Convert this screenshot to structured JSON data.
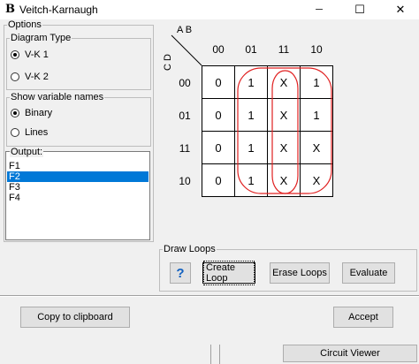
{
  "window": {
    "icon_glyph": "B",
    "title": "Veitch-Karnaugh",
    "min_glyph": "─",
    "max_glyph": "☐",
    "close_glyph": "✕"
  },
  "options": {
    "title": "Options",
    "diagram_type": {
      "title": "Diagram Type",
      "choices": [
        "V-K 1",
        "V-K 2"
      ],
      "selected": "V-K 1"
    },
    "variable_names": {
      "title": "Show variable names",
      "choices": [
        "Binary",
        "Lines"
      ],
      "selected": "Binary"
    }
  },
  "output": {
    "title": "Output:",
    "items": [
      "F1",
      "F2",
      "F3",
      "F4"
    ],
    "selected": "F2"
  },
  "kmap": {
    "row_var_label": "C D",
    "col_var_label": "A B",
    "col_headers": [
      "00",
      "01",
      "11",
      "10"
    ],
    "row_headers": [
      "00",
      "01",
      "11",
      "10"
    ],
    "cells": [
      [
        "0",
        "1",
        "X",
        "1"
      ],
      [
        "0",
        "1",
        "X",
        "1"
      ],
      [
        "0",
        "1",
        "X",
        "X"
      ],
      [
        "0",
        "1",
        "X",
        "X"
      ]
    ],
    "loop_color": "#e02020"
  },
  "draw_loops": {
    "title": "Draw Loops",
    "help_label": "?",
    "create_label": "Create Loop",
    "erase_label": "Erase Loops",
    "evaluate_label": "Evaluate"
  },
  "footer": {
    "copy_label": "Copy to clipboard",
    "accept_label": "Accept"
  },
  "background_window": {
    "label": "Circuit Viewer"
  }
}
